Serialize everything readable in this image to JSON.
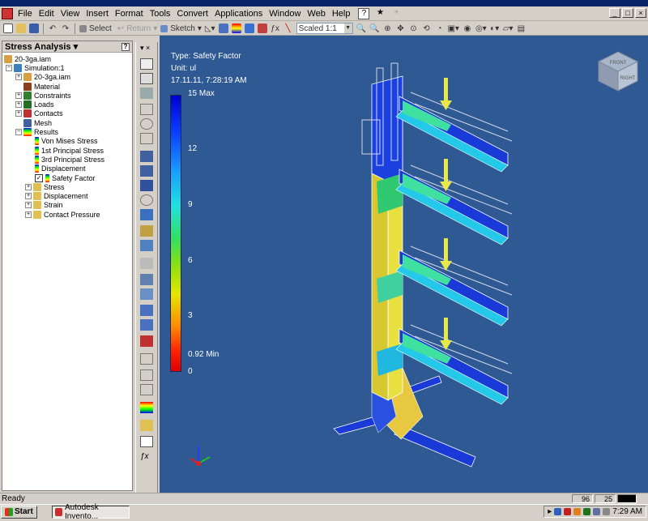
{
  "menu": {
    "items": [
      "File",
      "Edit",
      "View",
      "Insert",
      "Format",
      "Tools",
      "Convert",
      "Applications",
      "Window",
      "Web",
      "Help"
    ]
  },
  "window_buttons": [
    "_",
    "□",
    "×"
  ],
  "toolbar": {
    "select_label": "Select",
    "return_label": "Return",
    "sketch_label": "Sketch",
    "scale_value": "Scaled 1:1"
  },
  "browser": {
    "title": "Stress Analysis",
    "items": [
      {
        "label": "20-3ga.iam",
        "indent": 0
      },
      {
        "label": "Simulation:1",
        "indent": 1
      },
      {
        "label": "20-3ga.iam",
        "indent": 2
      },
      {
        "label": "Material",
        "indent": 2
      },
      {
        "label": "Constraints",
        "indent": 2
      },
      {
        "label": "Loads",
        "indent": 2
      },
      {
        "label": "Contacts",
        "indent": 2
      },
      {
        "label": "Mesh",
        "indent": 2
      },
      {
        "label": "Results",
        "indent": 2
      },
      {
        "label": "Von Mises Stress",
        "indent": 3
      },
      {
        "label": "1st Principal Stress",
        "indent": 3
      },
      {
        "label": "3rd Principal Stress",
        "indent": 3
      },
      {
        "label": "Displacement",
        "indent": 3
      },
      {
        "label": "Safety Factor",
        "indent": 3
      },
      {
        "label": "Stress",
        "indent": 2
      },
      {
        "label": "Displacement",
        "indent": 2
      },
      {
        "label": "Strain",
        "indent": 2
      },
      {
        "label": "Contact Pressure",
        "indent": 2
      }
    ]
  },
  "legend": {
    "type": "Type: Safety Factor",
    "unit": "Unit: ul",
    "timestamp": "17.11.11, 7:28:19 AM",
    "ticks": [
      {
        "label": "15 Max",
        "level": 15
      },
      {
        "label": "12",
        "level": 12
      },
      {
        "label": "9",
        "level": 9
      },
      {
        "label": "6",
        "level": 6
      },
      {
        "label": "3",
        "level": 3
      },
      {
        "label": "0.92 Min",
        "level": 0.92
      },
      {
        "label": "0",
        "level": 0
      }
    ]
  },
  "viewcube": {
    "top_label": "FRONT",
    "side_label": "RIGHT"
  },
  "status": {
    "text": "Ready",
    "field1": "96",
    "field2": "25"
  },
  "taskbar": {
    "start_label": "Start",
    "task_label": "Autodesk Invento...",
    "clock": "7:29 AM"
  },
  "colors": {
    "viewport_bg": "#2f5993",
    "title_bar": "#0a246a",
    "arrow_load": "#e8e84a"
  }
}
